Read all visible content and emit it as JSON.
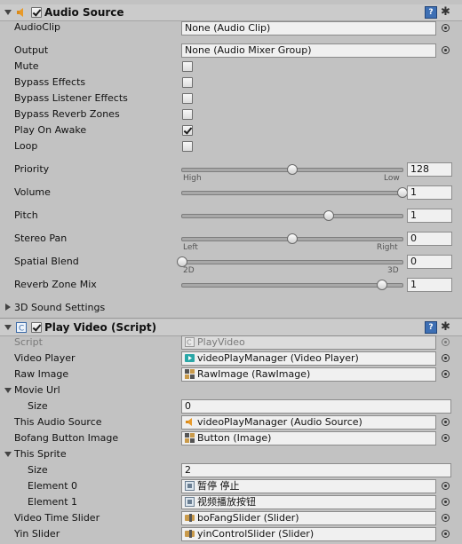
{
  "audio_source": {
    "title": "Audio Source",
    "audio_clip": {
      "label": "AudioClip",
      "value": "None (Audio Clip)"
    },
    "output": {
      "label": "Output",
      "value": "None (Audio Mixer Group)"
    },
    "toggles": [
      {
        "label": "Mute",
        "checked": false
      },
      {
        "label": "Bypass Effects",
        "checked": false
      },
      {
        "label": "Bypass Listener Effects",
        "checked": false
      },
      {
        "label": "Bypass Reverb Zones",
        "checked": false
      },
      {
        "label": "Play On Awake",
        "checked": true
      },
      {
        "label": "Loop",
        "checked": false
      }
    ],
    "priority": {
      "label": "Priority",
      "value": "128",
      "min_label": "High",
      "max_label": "Low",
      "fraction": 0.5
    },
    "volume": {
      "label": "Volume",
      "value": "1",
      "fraction": 1.0
    },
    "pitch": {
      "label": "Pitch",
      "value": "1",
      "fraction": 0.667
    },
    "stereo_pan": {
      "label": "Stereo Pan",
      "value": "0",
      "min_label": "Left",
      "max_label": "Right",
      "fraction": 0.5
    },
    "spatial_blend": {
      "label": "Spatial Blend",
      "value": "0",
      "min_label": "2D",
      "max_label": "3D",
      "fraction": 0.0
    },
    "reverb_zone_mix": {
      "label": "Reverb Zone Mix",
      "value": "1",
      "fraction": 0.909
    },
    "sound_settings": {
      "label": "3D Sound Settings"
    }
  },
  "play_video": {
    "title": "Play Video (Script)",
    "script": {
      "label": "Script",
      "value": "PlayVideo"
    },
    "video_player": {
      "label": "Video Player",
      "value": "videoPlayManager (Video Player)"
    },
    "raw_image": {
      "label": "Raw Image",
      "value": "RawImage (RawImage)"
    },
    "movie_url": {
      "label": "Movie Url",
      "size_label": "Size",
      "size_value": "0"
    },
    "this_audio_source": {
      "label": "This Audio Source",
      "value": "videoPlayManager (Audio Source)"
    },
    "bofang_button_image": {
      "label": "Bofang Button Image",
      "value": "Button (Image)"
    },
    "this_sprite": {
      "label": "This Sprite",
      "size_label": "Size",
      "size_value": "2",
      "elements": [
        {
          "label": "Element 0",
          "value": "暂停 停止"
        },
        {
          "label": "Element 1",
          "value": "视频播放按钮"
        }
      ]
    },
    "video_time_slider": {
      "label": "Video Time Slider",
      "value": "boFangSlider (Slider)"
    },
    "yin_slider": {
      "label": "Yin Slider",
      "value": "yinControlSlider (Slider)"
    }
  },
  "icons": {
    "help": "?",
    "gear": "✱"
  }
}
